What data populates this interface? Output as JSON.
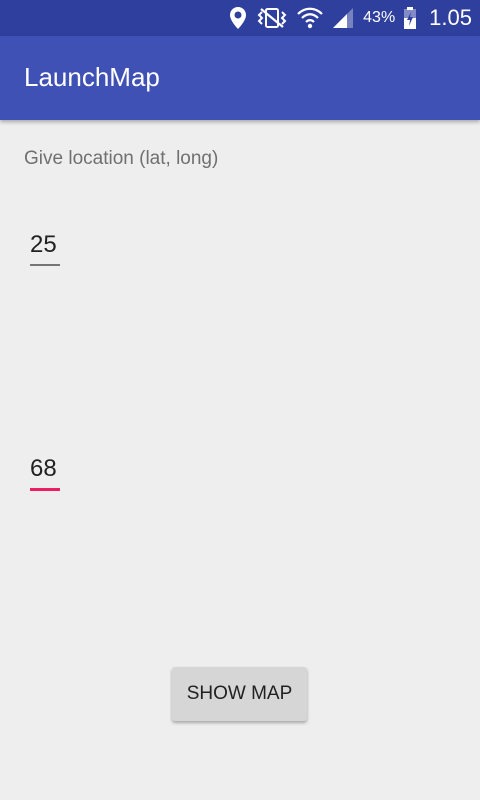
{
  "status_bar": {
    "battery_percent": "43%",
    "time": "1.05",
    "icons": [
      "location-icon",
      "vibrate-icon",
      "wifi-icon",
      "signal-icon",
      "battery-charging-icon"
    ]
  },
  "app_bar": {
    "title": "LaunchMap",
    "color": "#3f51b5"
  },
  "form": {
    "prompt": "Give location (lat, long)",
    "latitude": "25",
    "longitude": "68",
    "accent_color": "#e91e63"
  },
  "actions": {
    "show_map_label": "SHOW MAP"
  }
}
